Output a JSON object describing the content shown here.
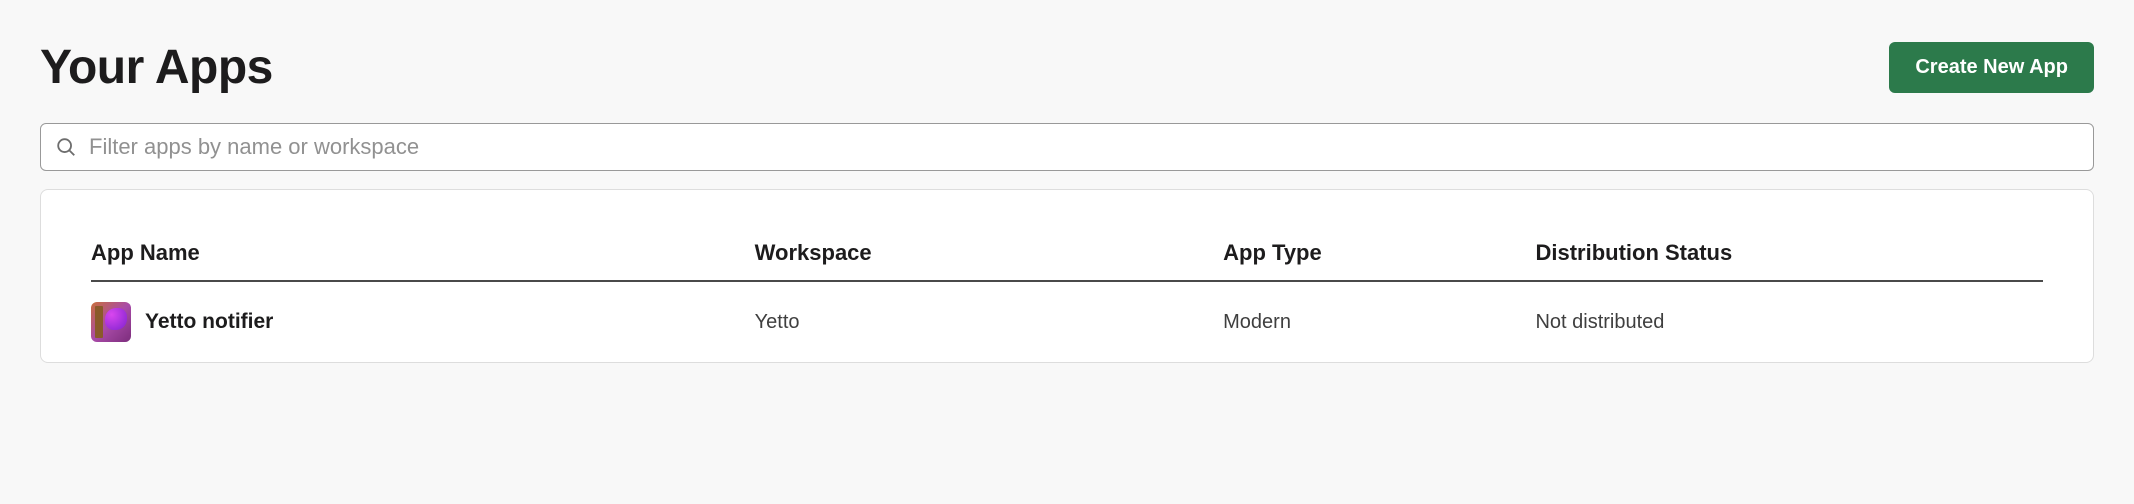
{
  "header": {
    "title": "Your Apps",
    "create_button": "Create New App"
  },
  "search": {
    "placeholder": "Filter apps by name or workspace",
    "value": ""
  },
  "table": {
    "columns": {
      "app_name": "App Name",
      "workspace": "Workspace",
      "app_type": "App Type",
      "distribution_status": "Distribution Status"
    },
    "rows": [
      {
        "app_name": "Yetto notifier",
        "workspace": "Yetto",
        "app_type": "Modern",
        "distribution_status": "Not distributed",
        "icon": "yetto-app-icon"
      }
    ]
  }
}
